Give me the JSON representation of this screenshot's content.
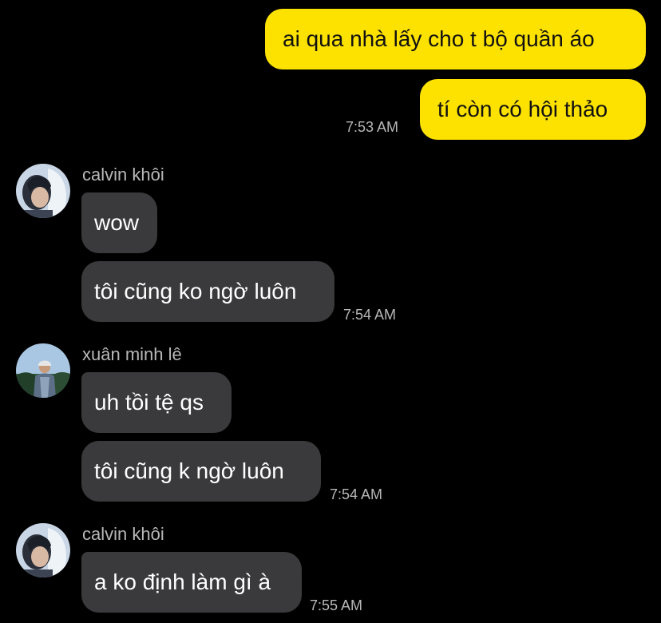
{
  "colors": {
    "background": "#000000",
    "outgoing_bubble": "#fde200",
    "incoming_bubble": "#3a3a3c",
    "timestamp_text": "#b8b8b8"
  },
  "messages": {
    "out_1": "ai qua nhà lấy cho t bộ quần áo",
    "out_2": "tí còn có hội thảo",
    "out_time": "7:53 AM",
    "group_1": {
      "sender": "calvin khôi",
      "avatar": "calvin-avatar",
      "msg_1": "wow",
      "msg_2": "tôi cũng ko ngờ luôn",
      "time": "7:54 AM"
    },
    "group_2": {
      "sender": "xuân minh lê",
      "avatar": "xuan-avatar",
      "msg_1": "uh tồi tệ qs",
      "msg_2": "tôi cũng k ngờ luôn",
      "time": "7:54 AM"
    },
    "group_3": {
      "sender": "calvin khôi",
      "avatar": "calvin-avatar",
      "msg_1": "a ko định làm gì à",
      "time": "7:55 AM"
    }
  }
}
